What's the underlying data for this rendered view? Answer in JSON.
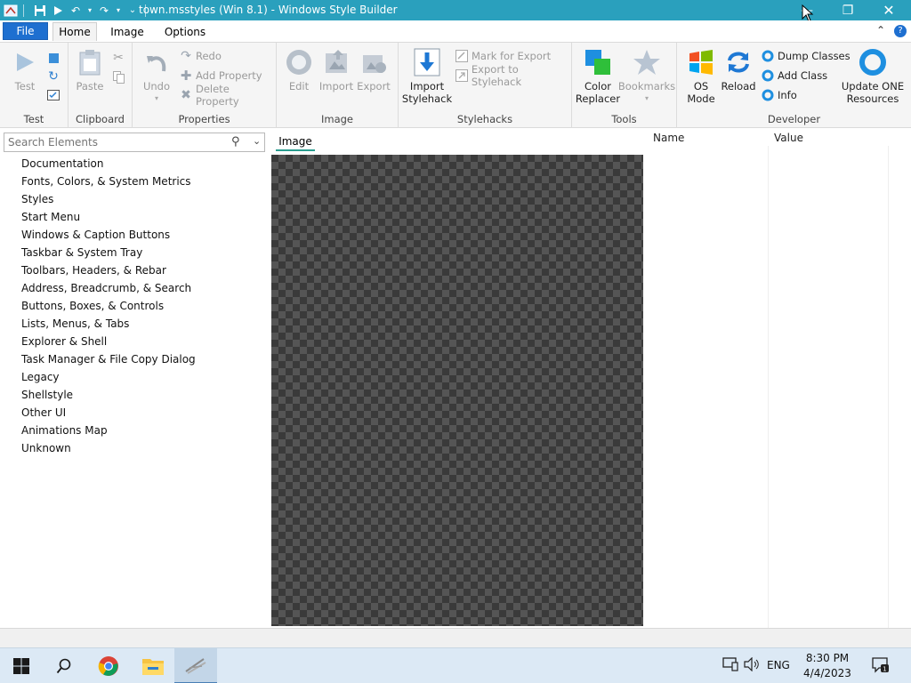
{
  "window": {
    "title": "town.msstyles (Win 8.1) - Windows Style Builder",
    "controls": [
      "minimize",
      "maximize",
      "close"
    ]
  },
  "menu": {
    "file": "File",
    "tabs": [
      "Home",
      "Image",
      "Options"
    ],
    "active_tab": "Home"
  },
  "ribbon": {
    "test": {
      "label": "Test",
      "test_button": "Test"
    },
    "clipboard": {
      "label": "Clipboard",
      "paste": "Paste"
    },
    "properties": {
      "label": "Properties",
      "undo": "Undo",
      "redo": "Redo",
      "add_property": "Add Property",
      "delete_property": "Delete Property"
    },
    "image": {
      "label": "Image",
      "edit": "Edit",
      "import": "Import",
      "export": "Export"
    },
    "stylehacks": {
      "label": "Stylehacks",
      "import_stylehack": "Import Stylehack",
      "mark_for_export": "Mark for Export",
      "export_to_stylehack": "Export to Stylehack"
    },
    "tools": {
      "label": "Tools",
      "color_replacer": "Color Replacer",
      "bookmarks": "Bookmarks"
    },
    "developer": {
      "label": "Developer",
      "os_mode": "OS Mode",
      "reload": "Reload",
      "dump_classes": "Dump Classes",
      "add_class": "Add Class",
      "info": "Info",
      "update_one": "Update ONE Resources"
    }
  },
  "search": {
    "placeholder": "Search Elements"
  },
  "tree": [
    "Documentation",
    "Fonts, Colors, & System Metrics",
    "Styles",
    "Start Menu",
    "Windows & Caption Buttons",
    "Taskbar & System Tray",
    "Toolbars, Headers, & Rebar",
    "Address, Breadcrumb, & Search",
    "Buttons, Boxes, & Controls",
    "Lists, Menus, & Tabs",
    "Explorer & Shell",
    "Task Manager & File Copy Dialog",
    "Legacy",
    "Shellstyle",
    "Other UI",
    "Animations Map",
    "Unknown"
  ],
  "preview": {
    "tab": "Image"
  },
  "props": {
    "name_header": "Name",
    "value_header": "Value"
  },
  "taskbar": {
    "apps": [
      "start-icon",
      "search-icon",
      "chrome-icon",
      "file-explorer-icon",
      "style-builder-icon"
    ],
    "language": "ENG",
    "time": "8:30 PM",
    "date": "4/4/2023"
  },
  "colors": {
    "titlebar": "#2aa0bd",
    "file_button": "#1e6fd0",
    "accent": "#2a9d8f"
  }
}
